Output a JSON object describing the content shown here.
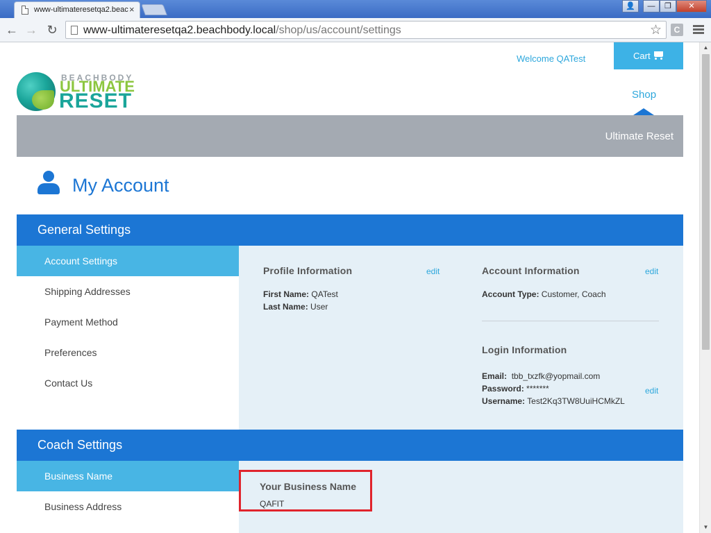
{
  "browser": {
    "tab_title": "www-ultimateresetqa2.beac",
    "tab_close": "×",
    "window_buttons": {
      "user": "👤",
      "minimize": "—",
      "maximize": "❐",
      "close": "✕"
    },
    "url_host": "www-ultimateresetqa2.beachbody.local",
    "url_path": "/shop/us/account/settings",
    "ext_badge": "C"
  },
  "header": {
    "welcome": "Welcome QATest",
    "cart_label": "Cart",
    "logo": {
      "brand_top": "BEACHBODY",
      "brand_mid": "ULTIMATE",
      "brand_bottom": "RESET"
    },
    "nav_shop": "Shop",
    "banner_text": "Ultimate Reset"
  },
  "page": {
    "title": "My Account"
  },
  "general": {
    "heading": "General Settings",
    "nav": [
      {
        "label": "Account Settings",
        "active": true
      },
      {
        "label": "Shipping Addresses",
        "active": false
      },
      {
        "label": "Payment Method",
        "active": false
      },
      {
        "label": "Preferences",
        "active": false
      },
      {
        "label": "Contact Us",
        "active": false
      }
    ],
    "profile": {
      "title": "Profile Information",
      "edit": "edit",
      "first_name_label": "First Name:",
      "first_name": "QATest",
      "last_name_label": "Last Name:",
      "last_name": "User"
    },
    "account": {
      "title": "Account Information",
      "edit": "edit",
      "type_label": "Account Type:",
      "type": "Customer, Coach"
    },
    "login": {
      "title": "Login Information",
      "edit": "edit",
      "email_label": "Email:",
      "email": "tbb_txzfk@yopmail.com",
      "password_label": "Password:",
      "password": "*******",
      "username_label": "Username:",
      "username": "Test2Kq3TW8UuiHCMkZL"
    }
  },
  "coach": {
    "heading": "Coach Settings",
    "nav": [
      {
        "label": "Business Name",
        "active": true
      },
      {
        "label": "Business Address",
        "active": false
      }
    ],
    "business_name_title": "Your Business Name",
    "business_name_value": "QAFIT"
  },
  "colors": {
    "primary_blue": "#1c76d4",
    "light_blue": "#48b5e4",
    "cart_blue": "#3db2e6",
    "panel_bg": "#e5f0f7",
    "banner_gray": "#a4aab2",
    "highlight_red": "#e0242c"
  }
}
